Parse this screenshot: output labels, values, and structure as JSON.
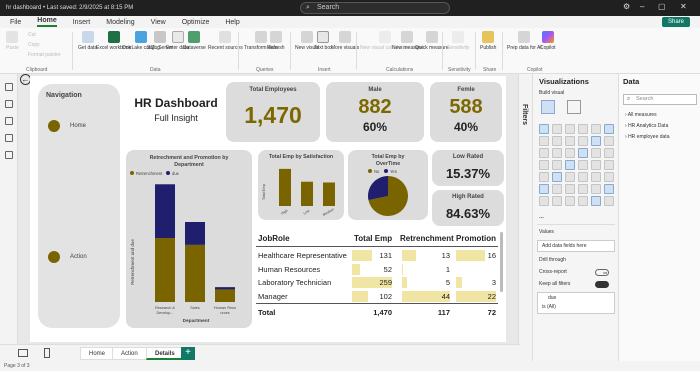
{
  "app": {
    "file_title": "hr dashboard",
    "saved_status": "Last saved: 2/9/2025 at 8:15 PM",
    "search_placeholder": "Search",
    "share_label": "Share"
  },
  "menu": [
    "File",
    "Home",
    "Insert",
    "Modeling",
    "View",
    "Optimize",
    "Help"
  ],
  "ribbon": {
    "clipboard": {
      "paste": "Paste",
      "cut": "Cut",
      "copy": "Copy",
      "format_painter": "Format painter",
      "group": "Clipboard"
    },
    "data": {
      "get_data": "Get data",
      "excel": "Excel workbook",
      "onelake": "OneLake catalog",
      "sql": "SQL Server",
      "enter": "Enter data",
      "dataverse": "Dataverse",
      "recent": "Recent sources",
      "group": "Data"
    },
    "queries": {
      "transform": "Transform data",
      "refresh": "Refresh",
      "group": "Queries"
    },
    "insert": {
      "new_visual": "New visual",
      "text_box": "Text box",
      "more_visuals": "More visuals",
      "group": "Insert"
    },
    "calculations": {
      "new_visual_calc": "New visual calculation",
      "new_measure": "New measure",
      "quick_measure": "Quick measure",
      "group": "Calculations"
    },
    "sensitivity": {
      "label": "Sensitivity",
      "group": "Sensitivity"
    },
    "share": {
      "publish": "Publish",
      "group": "Share"
    },
    "copilot": {
      "prep": "Prep data for AI",
      "copilot": "Copilot",
      "group": "Copilot"
    }
  },
  "dashboard": {
    "navigation_title": "Navigation",
    "nav_items": [
      "Home",
      "Action"
    ],
    "title": "HR Dashboard",
    "subtitle": "Full Insight",
    "total_employees": {
      "label": "Total Employees",
      "value": "1,470"
    },
    "male": {
      "label": "Male",
      "value": "882",
      "pct": "60%"
    },
    "female": {
      "label": "Femle",
      "value": "588",
      "pct": "40%"
    },
    "low_rated": {
      "label": "Low Rated",
      "value": "15.37%"
    },
    "high_rated": {
      "label": "High Rated",
      "value": "84.63%"
    }
  },
  "chart_retrenchment": {
    "type": "bar",
    "title": "Retrechment and Promotion by Department",
    "legend": [
      "Retrenchment",
      "due"
    ],
    "xlabel": "Department",
    "ylabel": "Retrenchment and due",
    "categories": [
      "Research & Develop...",
      "Sales",
      "Human Resources"
    ],
    "series": [
      {
        "name": "Retrenchment",
        "values": [
          56,
          50,
          11
        ],
        "color": "#7a6400"
      },
      {
        "name": "due",
        "values": [
          47,
          20,
          2
        ],
        "color": "#1f1f6e"
      }
    ],
    "ylim": [
      0,
      105
    ]
  },
  "chart_satisfaction": {
    "type": "bar",
    "title": "Total Emp by Satisfaction",
    "ylabel": "Total Emp",
    "categories": [
      "High",
      "Low",
      "Medium"
    ],
    "values": [
      442,
      289,
      280
    ],
    "ylim": [
      0,
      500
    ]
  },
  "chart_overtime": {
    "type": "pie",
    "title": "Total Emp by OverTime",
    "legend": [
      "No",
      "Yes"
    ],
    "values": [
      1054,
      416
    ],
    "colors": [
      "#7a6400",
      "#1f1f6e"
    ]
  },
  "table": {
    "type": "table",
    "columns": [
      "JobRole",
      "Total Emp",
      "Retrenchment",
      "Promotion"
    ],
    "rows": [
      {
        "role": "Healthcare Representative",
        "total": "131",
        "retr": "13",
        "promo": "16",
        "total_f": 0.51,
        "retr_f": 0.3,
        "promo_f": 0.73
      },
      {
        "role": "Human Resources",
        "total": "52",
        "retr": "1",
        "promo": "",
        "total_f": 0.2,
        "retr_f": 0.02,
        "promo_f": 0
      },
      {
        "role": "Laboratory Technician",
        "total": "259",
        "retr": "5",
        "promo": "3",
        "total_f": 1.0,
        "retr_f": 0.11,
        "promo_f": 0.14
      },
      {
        "role": "Manager",
        "total": "102",
        "retr": "44",
        "promo": "22",
        "total_f": 0.39,
        "retr_f": 1.0,
        "promo_f": 1.0
      }
    ],
    "total_label": "Total",
    "totals": {
      "total": "1,470",
      "retr": "117",
      "promo": "72"
    }
  },
  "page_tabs": [
    "Home",
    "Action",
    "Details"
  ],
  "status": "Page 3 of 3",
  "panes": {
    "filters": "Filters",
    "visualizations": "Visualizations",
    "build_visual": "Build visual",
    "data": "Data",
    "data_search": "Search",
    "data_items": [
      "All measures",
      "HR Analytics Data",
      "HR employee data"
    ],
    "values_label": "Values",
    "add_fields": "Add data fields here",
    "drill_through": "Drill through",
    "cross_report": "Cross-report",
    "cross_report_state": "Off",
    "keep_filters": "Keep all filters",
    "filter_field": "due",
    "filter_value": "is (All)"
  }
}
